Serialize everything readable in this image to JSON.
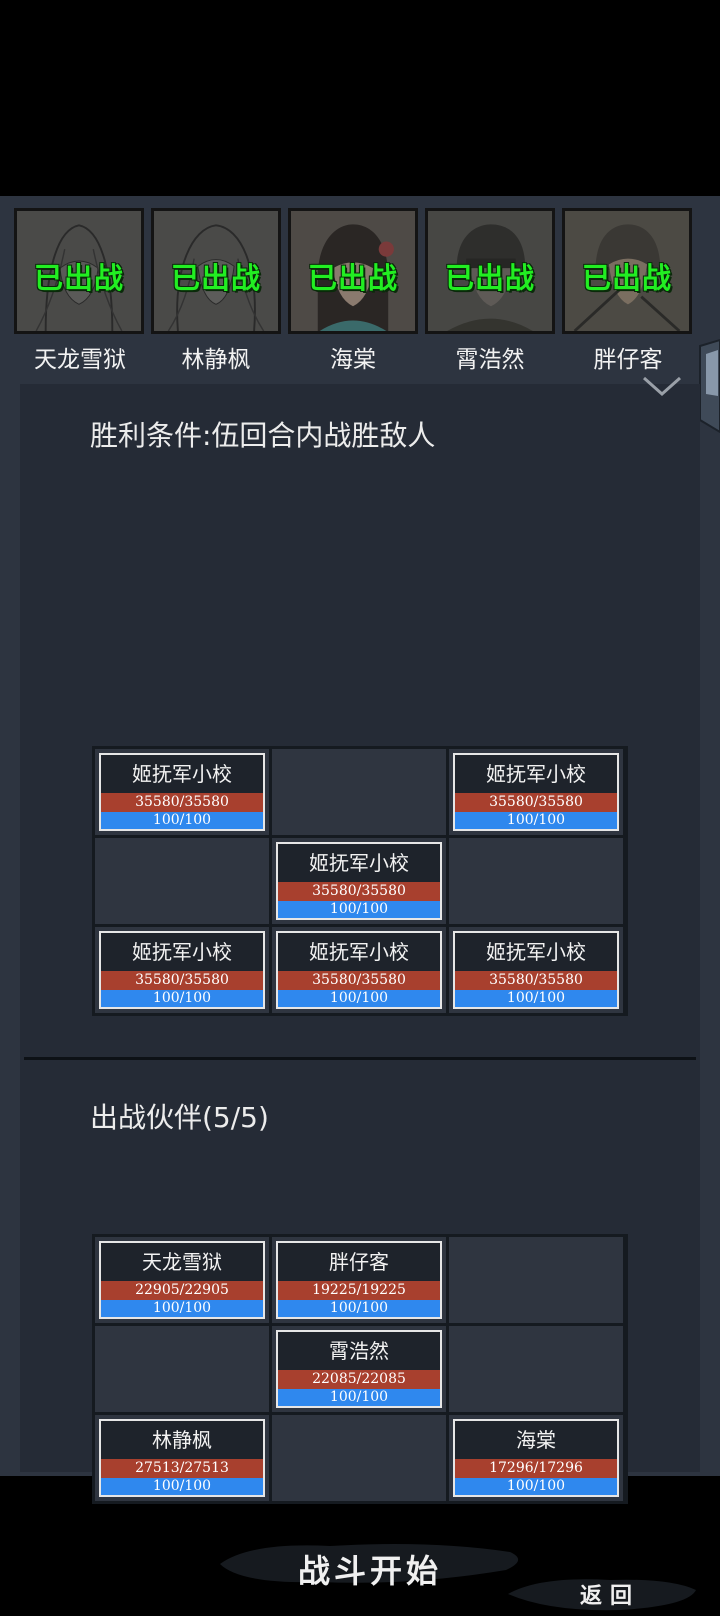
{
  "heroes": [
    {
      "name": "天龙雪狱",
      "status": "已出战"
    },
    {
      "name": "林静枫",
      "status": "已出战"
    },
    {
      "name": "海棠",
      "status": "已出战"
    },
    {
      "name": "霄浩然",
      "status": "已出战"
    },
    {
      "name": "胖仔客",
      "status": "已出战"
    }
  ],
  "victory_condition": "胜利条件:伍回合内战胜敌人",
  "enemy_grid": [
    {
      "name": "姬抚军小校",
      "hp": "35580/35580",
      "mp": "100/100"
    },
    null,
    {
      "name": "姬抚军小校",
      "hp": "35580/35580",
      "mp": "100/100"
    },
    null,
    {
      "name": "姬抚军小校",
      "hp": "35580/35580",
      "mp": "100/100"
    },
    null,
    {
      "name": "姬抚军小校",
      "hp": "35580/35580",
      "mp": "100/100"
    },
    {
      "name": "姬抚军小校",
      "hp": "35580/35580",
      "mp": "100/100"
    },
    {
      "name": "姬抚军小校",
      "hp": "35580/35580",
      "mp": "100/100"
    }
  ],
  "party_title": "出战伙伴(5/5)",
  "party_grid": [
    {
      "name": "天龙雪狱",
      "hp": "22905/22905",
      "mp": "100/100"
    },
    {
      "name": "胖仔客",
      "hp": "19225/19225",
      "mp": "100/100"
    },
    null,
    null,
    {
      "name": "霄浩然",
      "hp": "22085/22085",
      "mp": "100/100"
    },
    null,
    {
      "name": "林静枫",
      "hp": "27513/27513",
      "mp": "100/100"
    },
    null,
    {
      "name": "海棠",
      "hp": "17296/17296",
      "mp": "100/100"
    }
  ],
  "buttons": {
    "start": "战斗开始",
    "back": "返回"
  },
  "colors": {
    "deployed_text": "#22ee22",
    "hp_bar": "#a8402e",
    "mp_bar": "#2f88ee",
    "panel": "#252b36"
  }
}
